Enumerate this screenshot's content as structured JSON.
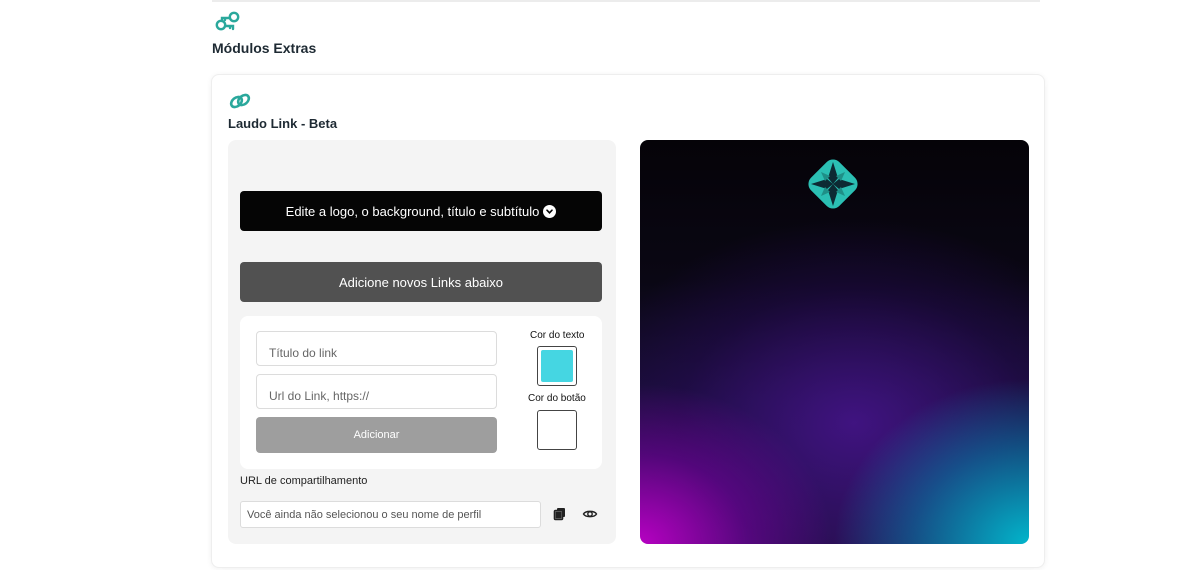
{
  "page": {
    "section_title": "Módulos Extras",
    "section_icon": "keys-icon"
  },
  "card": {
    "title": "Laudo Link - Beta",
    "icon": "link-icon",
    "edit_button_label": "Edite a logo, o background, título e subtítulo",
    "add_links_button_label": "Adicione novos Links abaixo",
    "form": {
      "title_placeholder": "Título do link",
      "url_placeholder": "Url do Link, https://",
      "add_button_label": "Adicionar",
      "text_color_label": "Cor do texto",
      "text_color_value": "#45d6e2",
      "button_color_label": "Cor do botão",
      "button_color_value": "#ffffff"
    },
    "share": {
      "label": "URL de compartilhamento",
      "placeholder": "Você ainda não selecionou o seu nome de perfil",
      "copy_icon": "copy-icon",
      "view_icon": "eye-icon"
    },
    "preview": {
      "logo_icon": "laudo-logo-icon",
      "accent_color": "#2bbfb3"
    }
  }
}
